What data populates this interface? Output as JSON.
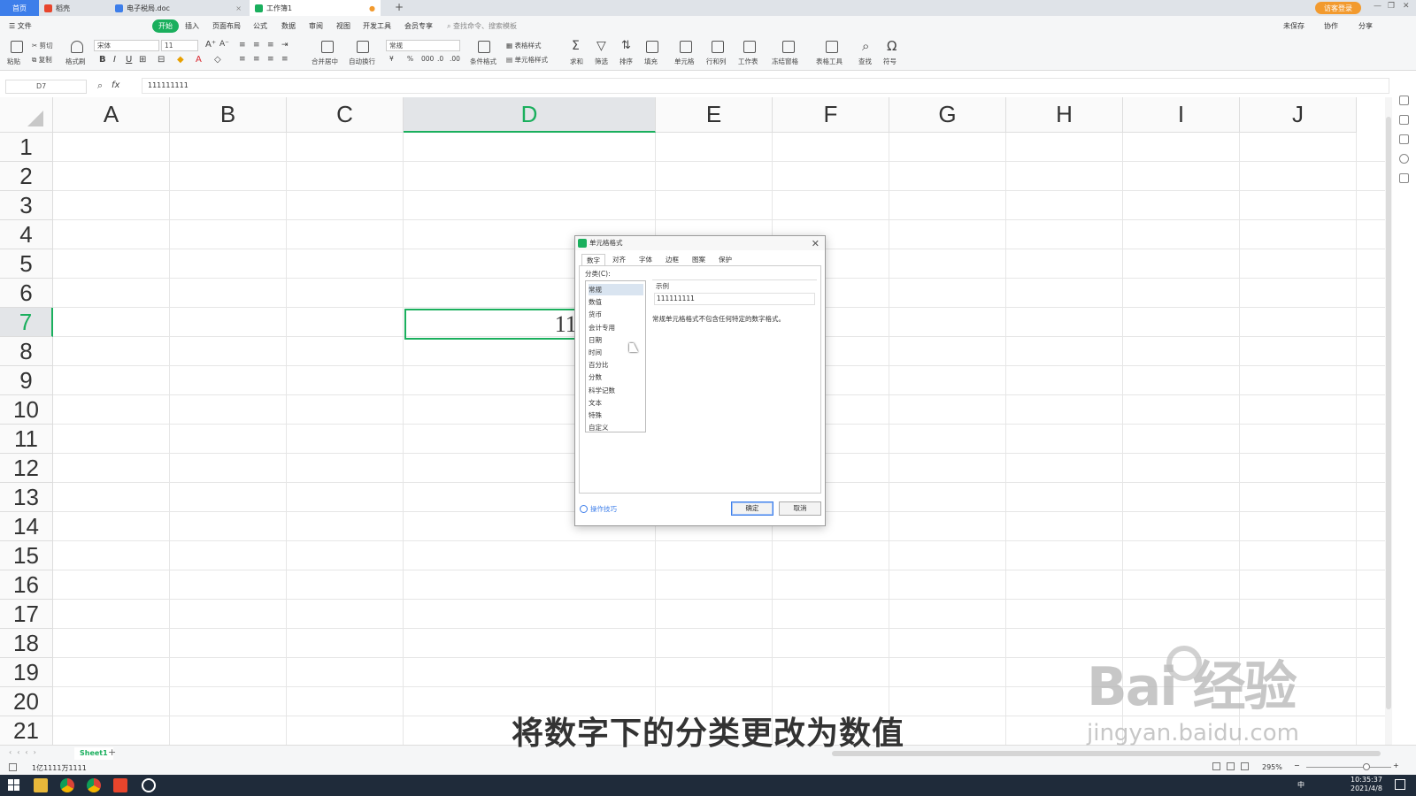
{
  "titlebar": {
    "tabs": [
      "首页",
      "稻壳",
      "电子税局.doc",
      "工作簿1"
    ],
    "login": "访客登录"
  },
  "menu": {
    "file": "文件",
    "items": [
      "开始",
      "插入",
      "页面布局",
      "公式",
      "数据",
      "审阅",
      "视图",
      "开发工具",
      "会员专享"
    ],
    "search": "查找命令、搜索模板",
    "right": [
      "未保存",
      "协作",
      "分享"
    ]
  },
  "ribbon": {
    "paste": "粘贴",
    "cut": "剪切",
    "copy": "复制",
    "format_painter": "格式刷",
    "font": "宋体",
    "size": "11",
    "number_format": "常规",
    "merge": "合并居中",
    "wrap": "自动换行",
    "cond_format": "条件格式",
    "table_style": "表格样式",
    "cell_style": "单元格样式",
    "sum": "求和",
    "filter": "筛选",
    "sort": "排序",
    "fill": "填充",
    "cell": "单元格",
    "rowcol": "行和列",
    "worksheet": "工作表",
    "freeze": "冻结窗格",
    "table_tools": "表格工具",
    "find": "查找",
    "symbol": "符号"
  },
  "formula_bar": {
    "name_box": "D7",
    "fx": "fx",
    "value": "111111111"
  },
  "sheet": {
    "columns": [
      "A",
      "B",
      "C",
      "D",
      "E",
      "F",
      "G",
      "H",
      "I",
      "J"
    ],
    "rows": [
      "1",
      "2",
      "3",
      "4",
      "5",
      "6",
      "7",
      "8",
      "9",
      "10",
      "11",
      "12",
      "13",
      "14",
      "15",
      "16",
      "17",
      "18",
      "19",
      "20",
      "21"
    ],
    "active_cell_text": "111111111"
  },
  "dialog": {
    "title": "单元格格式",
    "tabs": [
      "数字",
      "对齐",
      "字体",
      "边框",
      "图案",
      "保护"
    ],
    "category_label": "分类(C):",
    "categories": [
      "常规",
      "数值",
      "货币",
      "会计专用",
      "日期",
      "时间",
      "百分比",
      "分数",
      "科学记数",
      "文本",
      "特殊",
      "自定义"
    ],
    "sample_label": "示例",
    "sample_value": "111111111",
    "description": "常规单元格格式不包含任何特定的数字格式。",
    "tips": "操作技巧",
    "ok": "确定",
    "cancel": "取消"
  },
  "sheet_tab": "Sheet1",
  "status": {
    "left": "1亿1111万1111",
    "zoom": "295%"
  },
  "taskbar": {
    "time": "10:35:37",
    "date": "2021/4/8",
    "ime": "中"
  },
  "subtitle": "将数字下的分类更改为数值",
  "watermark": {
    "logo": "Bai 经验",
    "url": "jingyan.baidu.com"
  }
}
